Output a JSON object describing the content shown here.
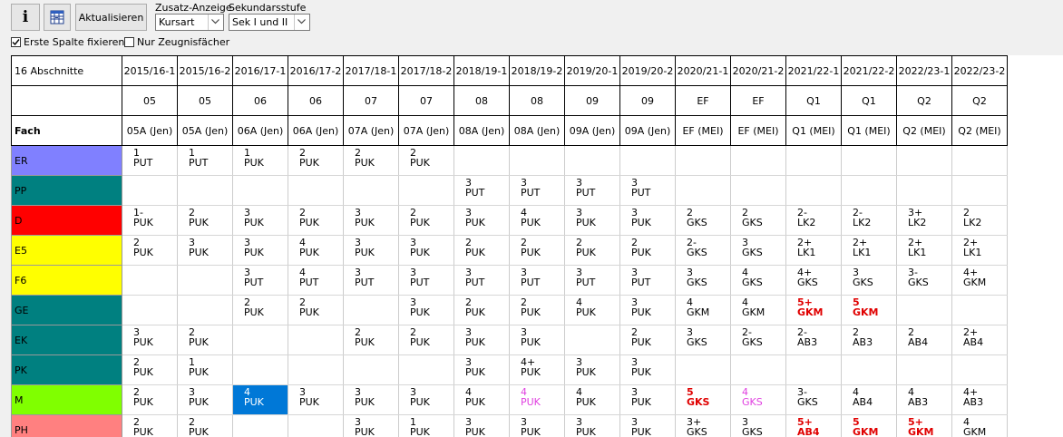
{
  "toolbar": {
    "info_label": "i",
    "refresh_label": "Aktualisieren",
    "zusatz_label": "Zusatz-Anzeige",
    "zusatz_value": "Kursart",
    "sek_label": "Sekundarsstufe",
    "sek_value": "Sek I und II",
    "fix_first_col_label": "Erste Spalte fixieren",
    "fix_first_col_checked": true,
    "only_report_subjects_label": "Nur Zeugnisfächer",
    "only_report_subjects_checked": false
  },
  "grid": {
    "header_sections": "16 Abschnitte",
    "header_fach": "Fach",
    "columns": [
      {
        "abschnitt": "2015/16-1",
        "stufe": "05",
        "klasse": "05A (Jen)"
      },
      {
        "abschnitt": "2015/16-2",
        "stufe": "05",
        "klasse": "05A (Jen)"
      },
      {
        "abschnitt": "2016/17-1",
        "stufe": "06",
        "klasse": "06A (Jen)"
      },
      {
        "abschnitt": "2016/17-2",
        "stufe": "06",
        "klasse": "06A (Jen)"
      },
      {
        "abschnitt": "2017/18-1",
        "stufe": "07",
        "klasse": "07A (Jen)"
      },
      {
        "abschnitt": "2017/18-2",
        "stufe": "07",
        "klasse": "07A (Jen)"
      },
      {
        "abschnitt": "2018/19-1",
        "stufe": "08",
        "klasse": "08A (Jen)"
      },
      {
        "abschnitt": "2018/19-2",
        "stufe": "08",
        "klasse": "08A (Jen)"
      },
      {
        "abschnitt": "2019/20-1",
        "stufe": "09",
        "klasse": "09A (Jen)"
      },
      {
        "abschnitt": "2019/20-2",
        "stufe": "09",
        "klasse": "09A (Jen)"
      },
      {
        "abschnitt": "2020/21-1",
        "stufe": "EF",
        "klasse": "EF (MEI)"
      },
      {
        "abschnitt": "2020/21-2",
        "stufe": "EF",
        "klasse": "EF (MEI)"
      },
      {
        "abschnitt": "2021/22-1",
        "stufe": "Q1",
        "klasse": "Q1 (MEI)"
      },
      {
        "abschnitt": "2021/22-2",
        "stufe": "Q1",
        "klasse": "Q1 (MEI)"
      },
      {
        "abschnitt": "2022/23-1",
        "stufe": "Q2",
        "klasse": "Q2 (MEI)"
      },
      {
        "abschnitt": "2022/23-2",
        "stufe": "Q2",
        "klasse": "Q2 (MEI)"
      }
    ],
    "subjects": [
      {
        "name": "ER",
        "color": "#8080ff",
        "cells": [
          {
            "g": "1",
            "k": "PUT"
          },
          {
            "g": "1",
            "k": "PUT"
          },
          {
            "g": "1",
            "k": "PUK"
          },
          {
            "g": "2",
            "k": "PUK"
          },
          {
            "g": "2",
            "k": "PUK"
          },
          {
            "g": "2",
            "k": "PUK"
          },
          null,
          null,
          null,
          null,
          null,
          null,
          null,
          null,
          null,
          null
        ]
      },
      {
        "name": "PP",
        "color": "#008080",
        "cells": [
          null,
          null,
          null,
          null,
          null,
          null,
          {
            "g": "3",
            "k": "PUT"
          },
          {
            "g": "3",
            "k": "PUT"
          },
          {
            "g": "3",
            "k": "PUT"
          },
          {
            "g": "3",
            "k": "PUT"
          },
          null,
          null,
          null,
          null,
          null,
          null
        ]
      },
      {
        "name": "D",
        "color": "#ff0000",
        "cells": [
          {
            "g": "1-",
            "k": "PUK"
          },
          {
            "g": "2",
            "k": "PUK"
          },
          {
            "g": "3",
            "k": "PUK"
          },
          {
            "g": "2",
            "k": "PUK"
          },
          {
            "g": "3",
            "k": "PUK"
          },
          {
            "g": "2",
            "k": "PUK"
          },
          {
            "g": "3",
            "k": "PUK"
          },
          {
            "g": "4",
            "k": "PUK"
          },
          {
            "g": "3",
            "k": "PUK"
          },
          {
            "g": "3",
            "k": "PUK"
          },
          {
            "g": "2",
            "k": "GKS"
          },
          {
            "g": "2",
            "k": "GKS"
          },
          {
            "g": "2-",
            "k": "LK2"
          },
          {
            "g": "2-",
            "k": "LK2"
          },
          {
            "g": "3+",
            "k": "LK2"
          },
          {
            "g": "2",
            "k": "LK2"
          }
        ]
      },
      {
        "name": "E5",
        "color": "#ffff00",
        "cells": [
          {
            "g": "2",
            "k": "PUK"
          },
          {
            "g": "3",
            "k": "PUK"
          },
          {
            "g": "3",
            "k": "PUK"
          },
          {
            "g": "4",
            "k": "PUK"
          },
          {
            "g": "3",
            "k": "PUK"
          },
          {
            "g": "3",
            "k": "PUK"
          },
          {
            "g": "2",
            "k": "PUK"
          },
          {
            "g": "2",
            "k": "PUK"
          },
          {
            "g": "2",
            "k": "PUK"
          },
          {
            "g": "2",
            "k": "PUK"
          },
          {
            "g": "2-",
            "k": "GKS"
          },
          {
            "g": "3",
            "k": "GKS"
          },
          {
            "g": "2+",
            "k": "LK1"
          },
          {
            "g": "2+",
            "k": "LK1"
          },
          {
            "g": "2+",
            "k": "LK1"
          },
          {
            "g": "2+",
            "k": "LK1"
          }
        ]
      },
      {
        "name": "F6",
        "color": "#ffff00",
        "cells": [
          null,
          null,
          {
            "g": "3",
            "k": "PUT"
          },
          {
            "g": "4",
            "k": "PUT"
          },
          {
            "g": "3",
            "k": "PUT"
          },
          {
            "g": "3",
            "k": "PUT"
          },
          {
            "g": "3",
            "k": "PUT"
          },
          {
            "g": "3",
            "k": "PUT"
          },
          {
            "g": "3",
            "k": "PUT"
          },
          {
            "g": "3",
            "k": "PUT"
          },
          {
            "g": "3",
            "k": "GKS"
          },
          {
            "g": "4",
            "k": "GKS"
          },
          {
            "g": "4+",
            "k": "GKS"
          },
          {
            "g": "3",
            "k": "GKS"
          },
          {
            "g": "3-",
            "k": "GKS"
          },
          {
            "g": "4+",
            "k": "GKM"
          }
        ]
      },
      {
        "name": "GE",
        "color": "#008080",
        "cells": [
          null,
          null,
          {
            "g": "2",
            "k": "PUK"
          },
          {
            "g": "2",
            "k": "PUK"
          },
          null,
          {
            "g": "3",
            "k": "PUK"
          },
          {
            "g": "2",
            "k": "PUK"
          },
          {
            "g": "2",
            "k": "PUK"
          },
          {
            "g": "4",
            "k": "PUK"
          },
          {
            "g": "3",
            "k": "PUK"
          },
          {
            "g": "4",
            "k": "GKM"
          },
          {
            "g": "4",
            "k": "GKM"
          },
          {
            "g": "5+",
            "k": "GKM",
            "s": "red"
          },
          {
            "g": "5",
            "k": "GKM",
            "s": "red"
          },
          null,
          null
        ]
      },
      {
        "name": "EK",
        "color": "#008080",
        "cells": [
          {
            "g": "3",
            "k": "PUK"
          },
          {
            "g": "2",
            "k": "PUK"
          },
          null,
          null,
          {
            "g": "2",
            "k": "PUK"
          },
          {
            "g": "2",
            "k": "PUK"
          },
          {
            "g": "3",
            "k": "PUK"
          },
          {
            "g": "3",
            "k": "PUK"
          },
          null,
          {
            "g": "2",
            "k": "PUK"
          },
          {
            "g": "3",
            "k": "GKS"
          },
          {
            "g": "2-",
            "k": "GKS"
          },
          {
            "g": "2-",
            "k": "AB3"
          },
          {
            "g": "2",
            "k": "AB3"
          },
          {
            "g": "2",
            "k": "AB4"
          },
          {
            "g": "2+",
            "k": "AB4"
          }
        ]
      },
      {
        "name": "PK",
        "color": "#008080",
        "cells": [
          {
            "g": "2",
            "k": "PUK"
          },
          {
            "g": "1",
            "k": "PUK"
          },
          null,
          null,
          null,
          null,
          {
            "g": "3",
            "k": "PUK"
          },
          {
            "g": "4+",
            "k": "PUK"
          },
          {
            "g": "3",
            "k": "PUK"
          },
          {
            "g": "3",
            "k": "PUK"
          },
          null,
          null,
          null,
          null,
          null,
          null
        ]
      },
      {
        "name": "M",
        "color": "#80ff00",
        "cells": [
          {
            "g": "2",
            "k": "PUK"
          },
          {
            "g": "3",
            "k": "PUK"
          },
          {
            "g": "4",
            "k": "PUK",
            "s": "sel"
          },
          {
            "g": "3",
            "k": "PUK"
          },
          {
            "g": "3",
            "k": "PUK"
          },
          {
            "g": "3",
            "k": "PUK"
          },
          {
            "g": "4",
            "k": "PUK"
          },
          {
            "g": "4",
            "k": "PUK",
            "s": "mag"
          },
          {
            "g": "4",
            "k": "PUK"
          },
          {
            "g": "3",
            "k": "PUK"
          },
          {
            "g": "5",
            "k": "GKS",
            "s": "red"
          },
          {
            "g": "4",
            "k": "GKS",
            "s": "mag"
          },
          {
            "g": "3-",
            "k": "GKS"
          },
          {
            "g": "4",
            "k": "AB4"
          },
          {
            "g": "4",
            "k": "AB3"
          },
          {
            "g": "4+",
            "k": "AB3"
          }
        ]
      },
      {
        "name": "PH",
        "color": "#ff8080",
        "cells": [
          {
            "g": "2",
            "k": "PUK"
          },
          {
            "g": "2",
            "k": "PUK"
          },
          null,
          null,
          {
            "g": "3",
            "k": "PUK"
          },
          {
            "g": "1",
            "k": "PUK"
          },
          {
            "g": "3",
            "k": "PUK"
          },
          {
            "g": "3",
            "k": "PUK"
          },
          {
            "g": "3",
            "k": "PUK"
          },
          {
            "g": "3",
            "k": "PUK"
          },
          {
            "g": "3+",
            "k": "GKS"
          },
          {
            "g": "3",
            "k": "GKS"
          },
          {
            "g": "5+",
            "k": "AB4",
            "s": "red"
          },
          {
            "g": "5",
            "k": "GKM",
            "s": "red"
          },
          {
            "g": "5+",
            "k": "GKM",
            "s": "red"
          },
          {
            "g": "4",
            "k": "GKM"
          }
        ]
      }
    ]
  }
}
